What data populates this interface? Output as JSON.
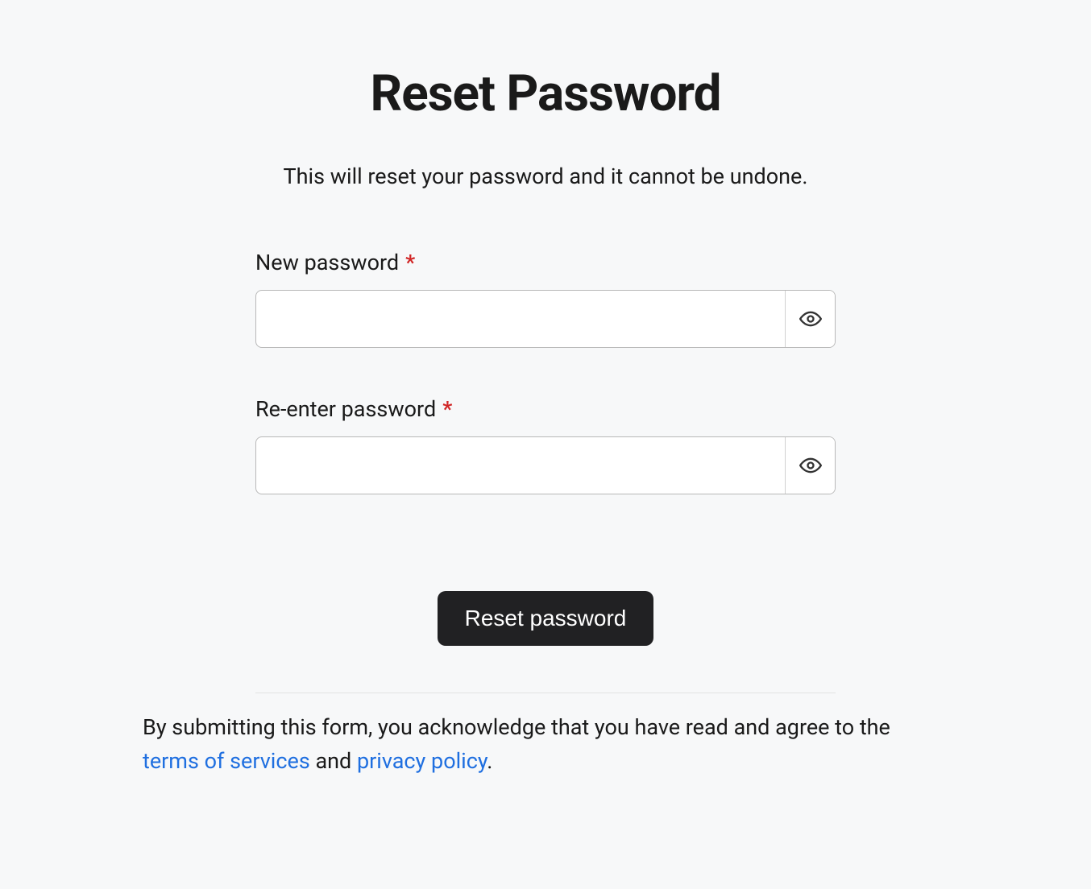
{
  "title": "Reset Password",
  "subtitle": "This will reset your password and it cannot be undone.",
  "required_mark": "*",
  "fields": {
    "new_password": {
      "label": "New password",
      "value": ""
    },
    "reenter_password": {
      "label": "Re-enter password",
      "value": ""
    }
  },
  "submit_label": "Reset password",
  "footer": {
    "prefix": "By submitting this form, you acknowledge that you have read and agree to the ",
    "terms_label": "terms of services",
    "and": " and ",
    "privacy_label": "privacy policy",
    "suffix": "."
  }
}
